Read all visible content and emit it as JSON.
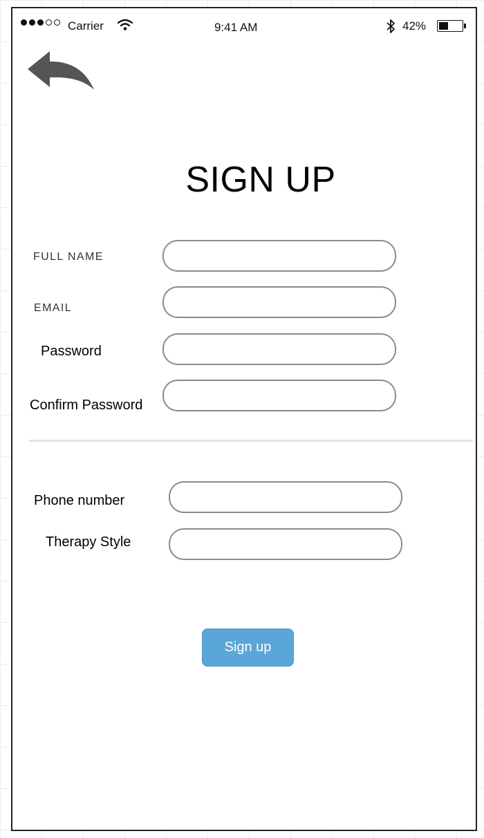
{
  "status_bar": {
    "carrier": "Carrier",
    "time": "9:41 AM",
    "battery_percent": "42%",
    "battery_level": 0.42,
    "signal_bars_filled": 3,
    "signal_bars_total": 5
  },
  "header": {
    "back_icon": "back-arrow-icon"
  },
  "title": "SIGN UP",
  "form": {
    "full_name": {
      "label": "FULL NAME",
      "value": "",
      "placeholder": ""
    },
    "email": {
      "label": "EMAIL",
      "value": "",
      "placeholder": ""
    },
    "password": {
      "label": "Password",
      "value": "",
      "placeholder": ""
    },
    "confirm_password": {
      "label": "Confirm Password",
      "value": "",
      "placeholder": ""
    },
    "phone_number": {
      "label": "Phone number",
      "value": "",
      "placeholder": ""
    },
    "therapy_style": {
      "label": "Therapy Style",
      "value": "",
      "placeholder": ""
    }
  },
  "submit": {
    "label": "Sign up",
    "color": "#5ba6d8"
  }
}
